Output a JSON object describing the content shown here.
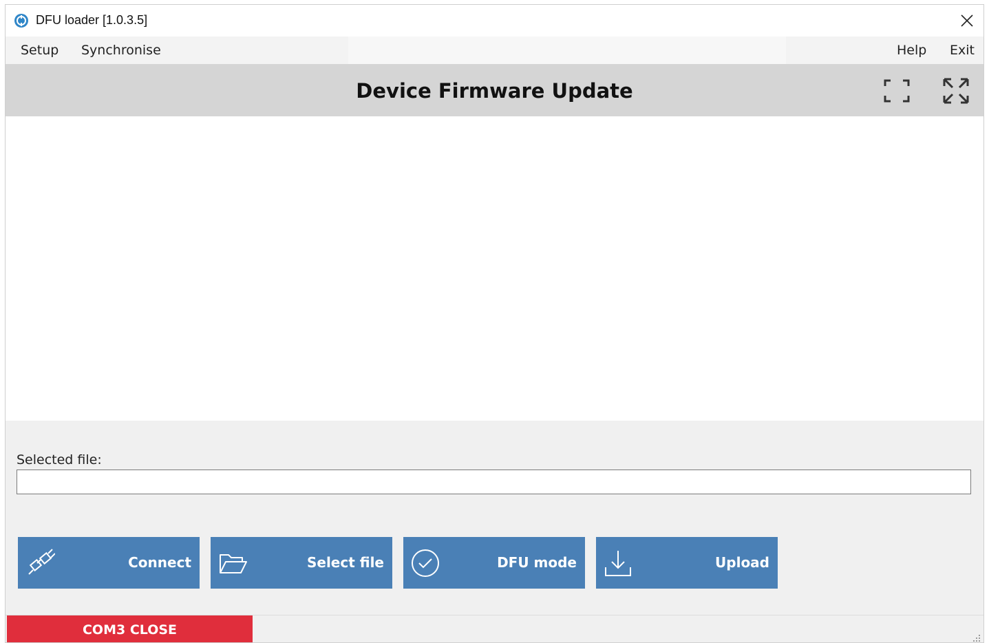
{
  "window": {
    "title": "DFU loader [1.0.3.5]",
    "icon": "app-logo-icon",
    "close_icon": "close-icon"
  },
  "menu": {
    "left": [
      "Setup",
      "Synchronise"
    ],
    "right": [
      "Help",
      "Exit"
    ]
  },
  "header": {
    "title": "Device Firmware Update",
    "icons": [
      "fullscreen-icon",
      "expand-icon"
    ]
  },
  "file": {
    "label": "Selected file:",
    "value": ""
  },
  "actions": [
    {
      "label": "Connect",
      "icon": "plug-icon"
    },
    {
      "label": "Select file",
      "icon": "folder-icon"
    },
    {
      "label": "DFU mode",
      "icon": "check-circle-icon"
    },
    {
      "label": "Upload",
      "icon": "download-icon"
    }
  ],
  "status": {
    "port": "COM3 CLOSE"
  },
  "colors": {
    "button": "#4a80b6",
    "status_closed": "#e02e3c",
    "header": "#d5d5d5",
    "panel": "#f0f0f0"
  }
}
